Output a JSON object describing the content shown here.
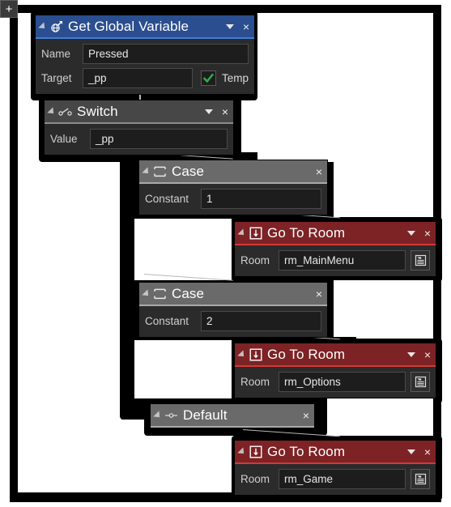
{
  "canvas": {
    "add_button_label": "+",
    "background_color": "#ffffff"
  },
  "colors": {
    "variable_block": "#2a4e8f",
    "variable_accent": "#3f7ddb",
    "control_block": "#474747",
    "control_block_light": "#6a6a6a",
    "room_block": "#7d2225",
    "room_accent": "#d13a36",
    "checkbox_check": "#2fa84f",
    "block_body": "#2b2b2b",
    "field_bg": "#1d1d1d"
  },
  "blocks": [
    {
      "id": "get-global-variable",
      "title": "Get Global Variable",
      "icon": "global-variable-icon",
      "theme": "blue",
      "has_caret": true,
      "close_label": "×",
      "fields": [
        {
          "label": "Name",
          "value": "Pressed"
        },
        {
          "label": "Target",
          "value": "_pp"
        }
      ],
      "checkbox": {
        "label": "Temp",
        "checked": true
      }
    },
    {
      "id": "switch",
      "title": "Switch",
      "icon": "switch-icon",
      "theme": "grey",
      "has_caret": true,
      "close_label": "×",
      "fields": [
        {
          "label": "Value",
          "value": "_pp"
        }
      ]
    },
    {
      "id": "case-1",
      "title": "Case",
      "icon": "case-loop-icon",
      "theme": "grey-light",
      "has_caret": false,
      "close_label": "×",
      "fields": [
        {
          "label": "Constant",
          "value": "1"
        }
      ]
    },
    {
      "id": "go-to-room-1",
      "title": "Go To Room",
      "icon": "go-to-room-icon",
      "theme": "red",
      "has_caret": true,
      "close_label": "×",
      "fields": [
        {
          "label": "Room",
          "value": "rm_MainMenu",
          "picker": "room-picker-icon"
        }
      ]
    },
    {
      "id": "case-2",
      "title": "Case",
      "icon": "case-loop-icon",
      "theme": "grey-light",
      "has_caret": false,
      "close_label": "×",
      "fields": [
        {
          "label": "Constant",
          "value": "2"
        }
      ]
    },
    {
      "id": "go-to-room-2",
      "title": "Go To Room",
      "icon": "go-to-room-icon",
      "theme": "red",
      "has_caret": true,
      "close_label": "×",
      "fields": [
        {
          "label": "Room",
          "value": "rm_Options",
          "picker": "room-picker-icon"
        }
      ]
    },
    {
      "id": "default",
      "title": "Default",
      "icon": "default-case-icon",
      "theme": "grey-light",
      "has_caret": false,
      "close_label": "×",
      "fields": []
    },
    {
      "id": "go-to-room-3",
      "title": "Go To Room",
      "icon": "go-to-room-icon",
      "theme": "red",
      "has_caret": true,
      "close_label": "×",
      "fields": [
        {
          "label": "Room",
          "value": "rm_Game",
          "picker": "room-picker-icon"
        }
      ]
    }
  ]
}
